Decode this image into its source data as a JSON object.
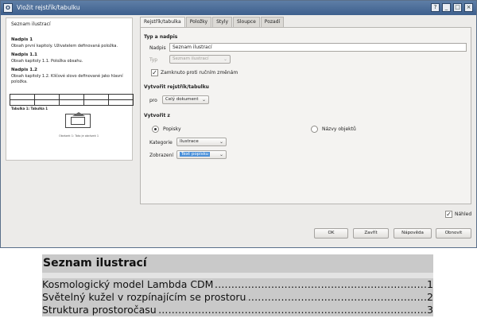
{
  "window": {
    "title": "Vložit rejstřík/tabulku",
    "icon_letter": "O",
    "controls": [
      "?",
      "_",
      "□",
      "×"
    ]
  },
  "preview": {
    "title": "Seznam ilustrací",
    "items": [
      {
        "heading": "Nadpis 1",
        "text": "Obsah první kapitoly. Uživatelem definovaná položka."
      },
      {
        "heading": "Nadpis 1.1",
        "text": "Obsah kapitoly 1.1. Položka obsahu."
      },
      {
        "heading": "Nadpis 1.2",
        "text": "Obsah kapitoly 1.2. Klíčové slovo definované jako hlavní položka."
      }
    ],
    "table_caption": "Tabulka 1: Tabulka 1",
    "image_caption": "Obrázek 1: Toto je obrázek 1"
  },
  "tabs": [
    {
      "label": "Rejstřík/tabulka",
      "active": true
    },
    {
      "label": "Položky",
      "active": false
    },
    {
      "label": "Styly",
      "active": false
    },
    {
      "label": "Sloupce",
      "active": false
    },
    {
      "label": "Pozadí",
      "active": false
    }
  ],
  "type_section": {
    "heading": "Typ a nadpis",
    "title_label": "Nadpis",
    "title_value": "Seznam ilustrací",
    "type_label": "Typ",
    "type_value": "Seznam ilustrací",
    "protect_label": "Zamknuto proti ručním změnám",
    "protect_checked": true
  },
  "create_for": {
    "heading": "Vytvořit rejstřík/tabulku",
    "for_label": "pro",
    "for_value": "Celý dokument"
  },
  "create_from": {
    "heading": "Vytvořit z",
    "captions_label": "Popisky",
    "captions_selected": true,
    "object_names_label": "Názvy objektů",
    "category_label": "Kategorie",
    "category_value": "Ilustrace",
    "display_label": "Zobrazení",
    "display_value": "Text popisku"
  },
  "preview_toggle": {
    "label": "Náhled",
    "checked": true
  },
  "buttons": {
    "ok": "OK",
    "close": "Zavřít",
    "help": "Nápověda",
    "reset": "Obnovit"
  },
  "document": {
    "title": "Seznam ilustrací",
    "entries": [
      {
        "text": "Kosmologický model Lambda CDM",
        "page": "1"
      },
      {
        "text": "Světelný kužel v rozpínajícím se prostoru",
        "page": "2"
      },
      {
        "text": "Struktura prostoročasu",
        "page": "3"
      }
    ]
  }
}
